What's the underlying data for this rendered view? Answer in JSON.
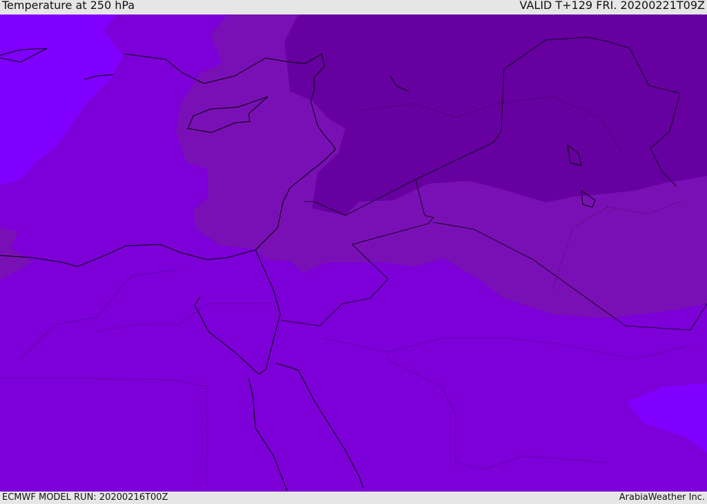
{
  "header": {
    "title": "Temperature at 250 hPa",
    "valid": "VALID T+129 FRI. 20200221T09Z"
  },
  "footer": {
    "model_run": "ECMWF MODEL RUN: 20200216T00Z",
    "credit": "ArabiaWeather Inc."
  },
  "colors": {
    "base": "#7d00d8",
    "warm": "#8000ff",
    "mid": "#7910b5",
    "cold": "#6600a0",
    "background": "#e6e6e6"
  }
}
